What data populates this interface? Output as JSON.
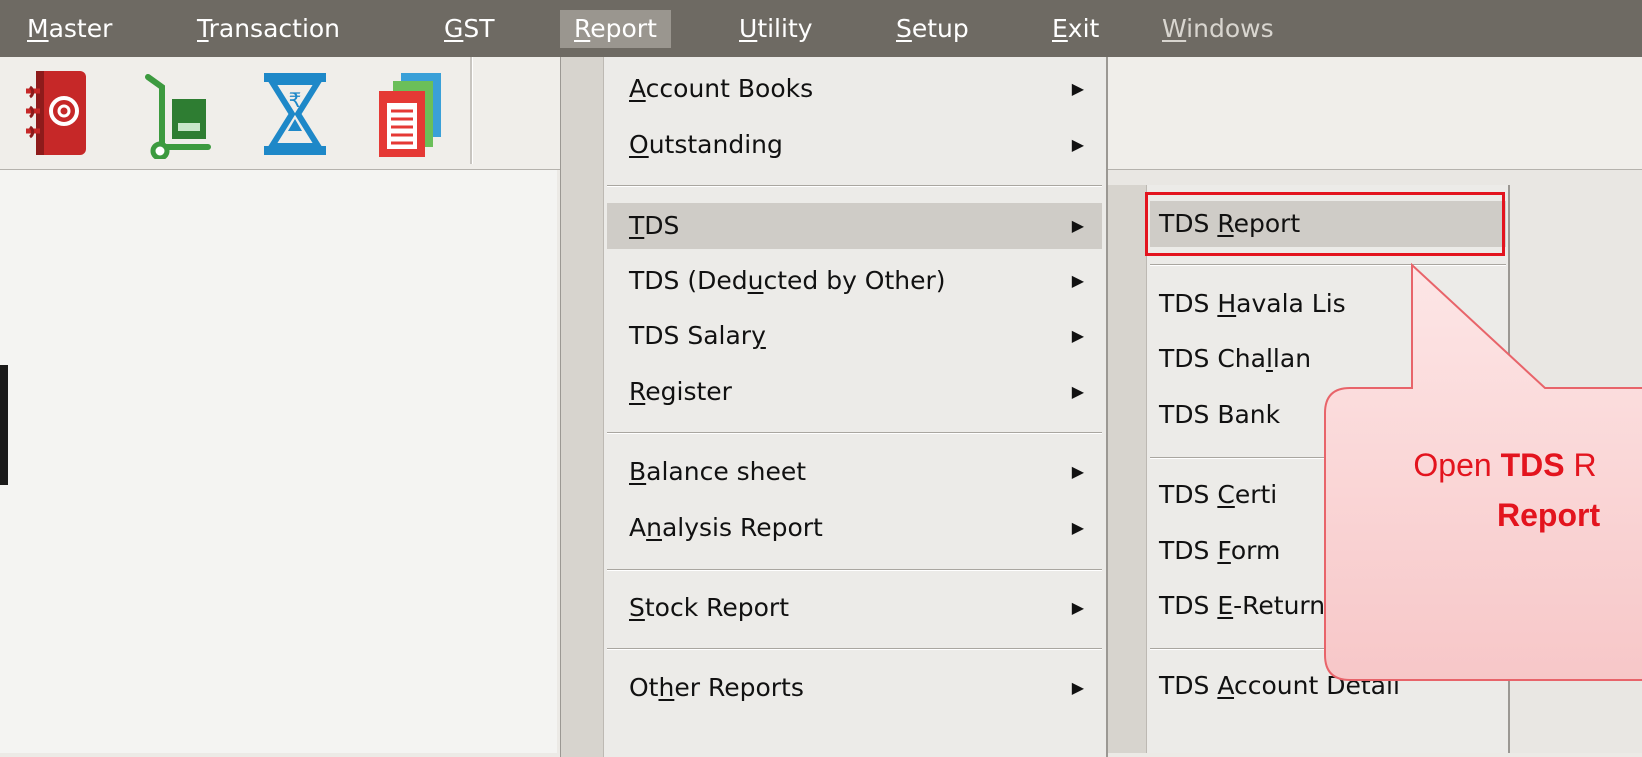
{
  "menubar": {
    "items": [
      {
        "pre": "",
        "u": "M",
        "post": "aster"
      },
      {
        "pre": "",
        "u": "T",
        "post": "ransaction"
      },
      {
        "pre": "",
        "u": "G",
        "post": "ST"
      },
      {
        "pre": "",
        "u": "R",
        "post": "eport"
      },
      {
        "pre": "",
        "u": "U",
        "post": "tility"
      },
      {
        "pre": "",
        "u": "S",
        "post": "etup"
      },
      {
        "pre": "",
        "u": "E",
        "post": "xit"
      },
      {
        "pre": "",
        "u": "W",
        "post": "indows"
      }
    ]
  },
  "toolbar": {
    "icons": [
      "address-book-icon",
      "hand-truck-icon",
      "hourglass-rupee-icon",
      "documents-icon"
    ],
    "colors": {
      "address_book": "#c62828",
      "hand_truck": "#2e7d32",
      "hourglass": "#1e88c8",
      "documents": "#e53935"
    }
  },
  "report_menu": {
    "items": [
      {
        "pre": "",
        "u": "A",
        "post": "ccount Books"
      },
      {
        "pre": "",
        "u": "O",
        "post": "utstanding"
      },
      {
        "pre": "",
        "u": "T",
        "post": "DS"
      },
      {
        "pre": "TDS (Ded",
        "u": "u",
        "post": "cted by Other)"
      },
      {
        "pre": "TDS Salar",
        "u": "y",
        "post": ""
      },
      {
        "pre": "",
        "u": "R",
        "post": "egister"
      },
      {
        "pre": "",
        "u": "B",
        "post": "alance sheet"
      },
      {
        "pre": "A",
        "u": "n",
        "post": "alysis Report"
      },
      {
        "pre": "",
        "u": "S",
        "post": "tock Report"
      },
      {
        "pre": "Ot",
        "u": "h",
        "post": "er Reports"
      }
    ]
  },
  "tds_submenu": {
    "items": [
      {
        "pre": "TDS ",
        "u": "R",
        "post": "eport"
      },
      {
        "pre": "TDS ",
        "u": "H",
        "post": "avala Lis"
      },
      {
        "pre": "TDS Cha",
        "u": "l",
        "post": "lan"
      },
      {
        "pre": "TDS Bank",
        "u": "",
        "post": ""
      },
      {
        "pre": "TDS ",
        "u": "C",
        "post": "erti"
      },
      {
        "pre": "TDS ",
        "u": "F",
        "post": "orm"
      },
      {
        "pre": "TDS ",
        "u": "E",
        "post": "-Return"
      },
      {
        "pre": "TDS ",
        "u": "A",
        "post": "ccount Detail"
      }
    ]
  },
  "callout": {
    "line1_pre": "Open ",
    "line1_bold": "TDS",
    "line1_post": " R",
    "line2_bold": "Report"
  },
  "colors": {
    "accent": "#e3141e",
    "menubar": "#6e6a63"
  }
}
